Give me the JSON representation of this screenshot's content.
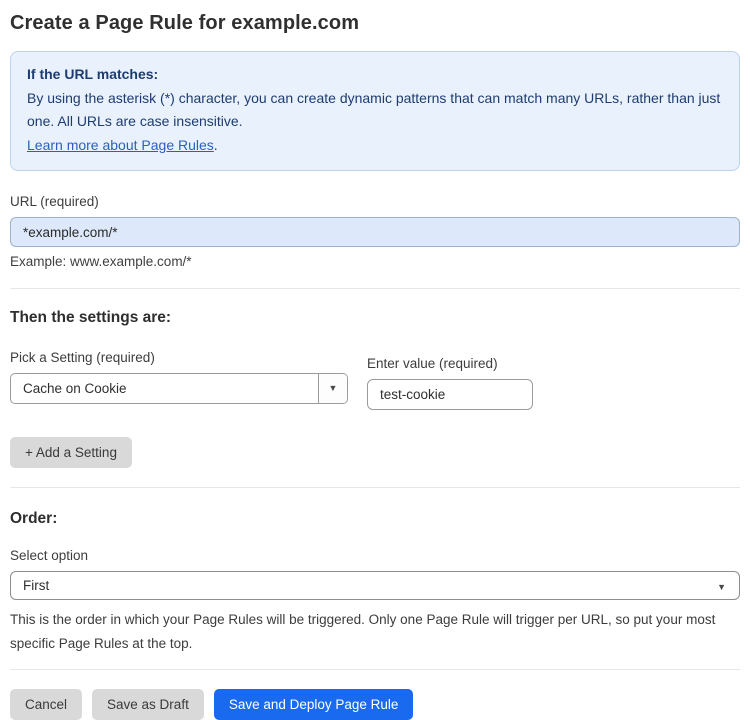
{
  "page": {
    "title": "Create a Page Rule for example.com"
  },
  "info_box": {
    "heading": "If the URL matches:",
    "body": "By using the asterisk (*) character, you can create dynamic patterns that can match many URLs, rather than just one. All URLs are case insensitive.",
    "link": "Learn more about Page Rules",
    "link_suffix": "."
  },
  "url_field": {
    "label": "URL (required)",
    "value": "*example.com/*",
    "helper": "Example: www.example.com/*"
  },
  "settings": {
    "heading": "Then the settings are:",
    "setting_label": "Pick a Setting (required)",
    "setting_selected": "Cache on Cookie",
    "value_label": "Enter value (required)",
    "value_current": "test-cookie",
    "add_button_label": "+ Add a Setting"
  },
  "order": {
    "heading": "Order:",
    "select_label": "Select option",
    "selected_option": "First",
    "helper": "This is the order in which your Page Rules will be triggered. Only one Page Rule will trigger per URL, so put your most specific Page Rules at the top."
  },
  "actions": {
    "cancel": "Cancel",
    "save_draft": "Save as Draft",
    "save_deploy": "Save and Deploy Page Rule"
  },
  "icons": {
    "dropdown_arrow": "▼"
  },
  "colors": {
    "accent_blue": "#1a6af0",
    "info_box_bg": "#e9f2fc",
    "info_box_border": "#bad4ef",
    "info_text": "#1e3c70",
    "link_blue": "#2d5dbe",
    "url_input_bg": "#dde9fa",
    "url_input_border": "#9db3d1",
    "gray_button_bg": "#d9d9d9"
  }
}
